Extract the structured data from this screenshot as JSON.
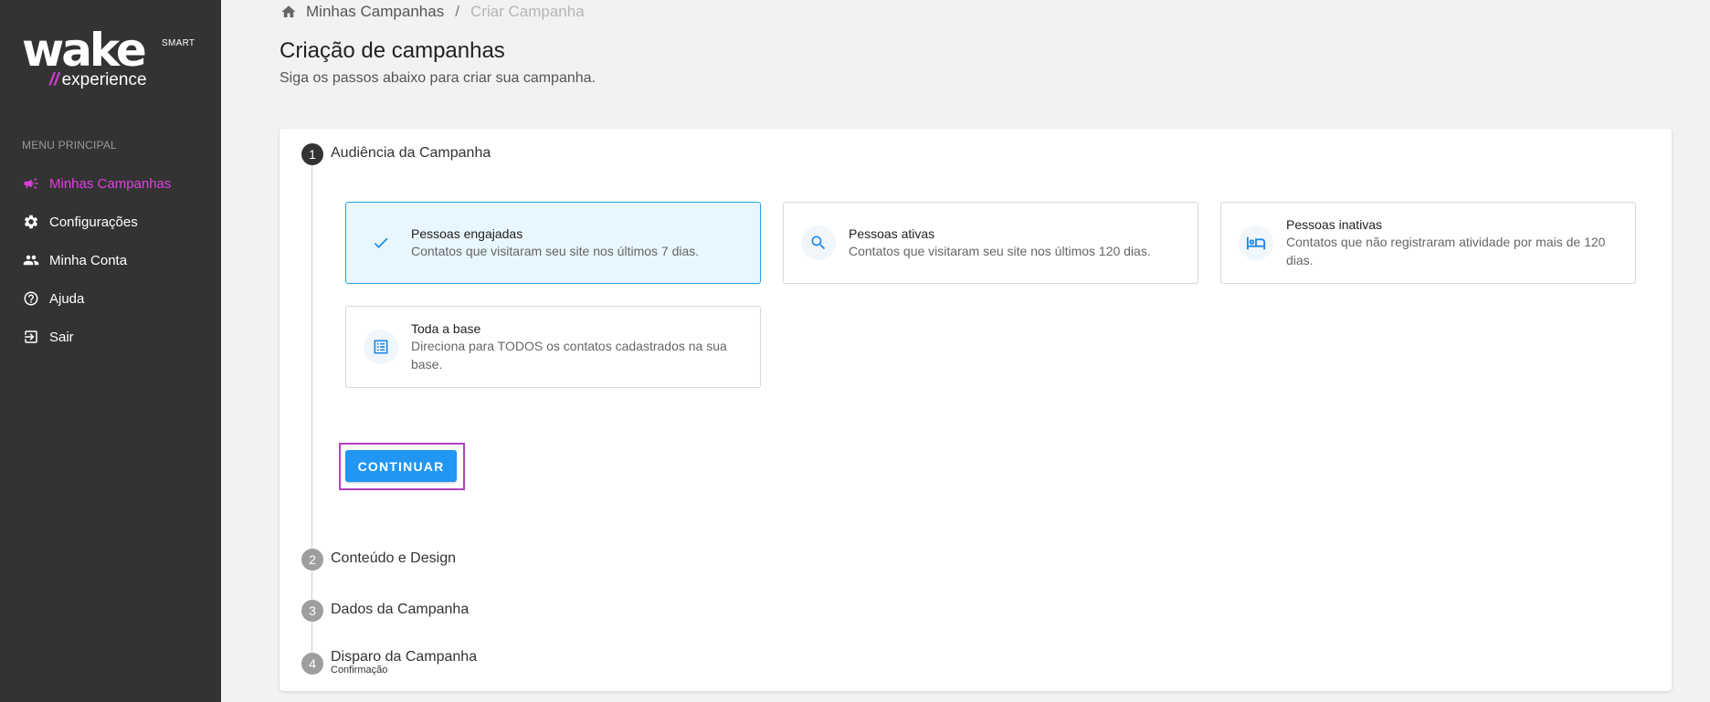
{
  "brand": {
    "logo_word": "wake",
    "logo_tag": "SMART",
    "logo_sub": "experience",
    "accent": "#e040e0",
    "sidebar_bg": "#333333",
    "primary": "#2196f3"
  },
  "sidebar": {
    "menu_title": "MENU PRINCIPAL",
    "items": [
      {
        "label": "Minhas Campanhas",
        "icon": "megaphone-icon",
        "active": true
      },
      {
        "label": "Configurações",
        "icon": "gear-icon",
        "active": false
      },
      {
        "label": "Minha Conta",
        "icon": "people-icon",
        "active": false
      },
      {
        "label": "Ajuda",
        "icon": "help-icon",
        "active": false
      },
      {
        "label": "Sair",
        "icon": "logout-icon",
        "active": false
      }
    ]
  },
  "breadcrumb": {
    "home_icon": "home-icon",
    "link": "Minhas Campanhas",
    "separator": "/",
    "current": "Criar Campanha"
  },
  "header": {
    "title": "Criação de campanhas",
    "subtitle": "Siga os passos abaixo para criar sua campanha."
  },
  "steps": [
    {
      "number": "1",
      "label": "Audiência da Campanha",
      "active": true
    },
    {
      "number": "2",
      "label": "Conteúdo e Design",
      "active": false
    },
    {
      "number": "3",
      "label": "Dados da Campanha",
      "active": false
    },
    {
      "number": "4",
      "label": "Disparo da Campanha",
      "sublabel": "Confirmação",
      "active": false
    }
  ],
  "audience_options": [
    {
      "title": "Pessoas engajadas",
      "desc": "Contatos que visitaram seu site nos últimos 7 dias.",
      "icon": "check-icon",
      "selected": true
    },
    {
      "title": "Pessoas ativas",
      "desc": "Contatos que visitaram seu site nos últimos 120 dias.",
      "icon": "search-icon",
      "selected": false
    },
    {
      "title": "Pessoas inativas",
      "desc": "Contatos que não registraram atividade por mais de 120 dias.",
      "icon": "bed-icon",
      "selected": false
    },
    {
      "title": "Toda a base",
      "desc": "Direciona para TODOS os contatos cadastrados na sua base.",
      "icon": "list-icon",
      "selected": false
    }
  ],
  "continue_label": "CONTINUAR"
}
